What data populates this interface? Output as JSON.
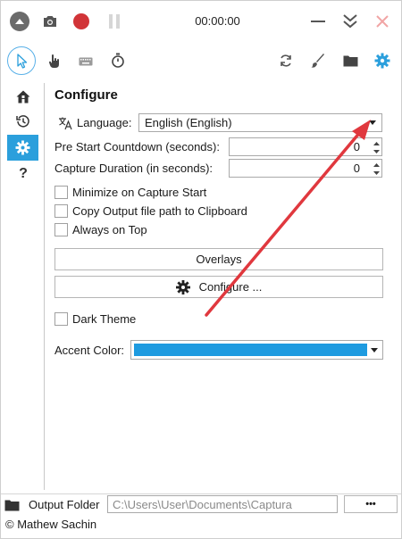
{
  "titlebar": {
    "timer": "00:00:00"
  },
  "icons": {
    "collapse": "chevron-up-icon",
    "screenshot": "camera-icon",
    "record": "record-icon",
    "pause": "pause-icon",
    "minimize": "minimize-icon",
    "compact": "double-chevron-down-icon",
    "close": "close-icon",
    "cursor": "cursor-icon",
    "hand": "hand-icon",
    "keyboard": "keyboard-icon",
    "stopwatch": "stopwatch-icon",
    "refresh": "refresh-icon",
    "brush": "brush-icon",
    "folder": "folder-icon",
    "settings": "gear-icon"
  },
  "sidebar": {
    "items": [
      "home-icon",
      "history-icon",
      "gear-icon",
      "help-icon"
    ],
    "active_index": 2,
    "help_glyph": "?"
  },
  "configure": {
    "title": "Configure",
    "language_label": "Language:",
    "language_value": "English (English)",
    "countdown_label": "Pre Start Countdown (seconds):",
    "countdown_value": "0",
    "duration_label": "Capture Duration (in seconds):",
    "duration_value": "0",
    "checkboxes": [
      {
        "label": "Minimize on Capture Start",
        "checked": false
      },
      {
        "label": "Copy Output file path to Clipboard",
        "checked": false
      },
      {
        "label": "Always on Top",
        "checked": false
      }
    ],
    "overlays_button": "Overlays",
    "configure_button": "Configure ...",
    "dark_theme_label": "Dark Theme",
    "dark_theme_checked": false,
    "accent_label": "Accent Color:",
    "accent_color": "#1e9be0"
  },
  "footer": {
    "output_folder_label": "Output Folder",
    "output_path": "C:\\Users\\User\\Documents\\Captura",
    "browse_button": "•••",
    "copyright": "© Mathew Sachin"
  },
  "colors": {
    "accent": "#2b9fdc",
    "record": "#d13438",
    "annotation_arrow": "#e0383e"
  }
}
